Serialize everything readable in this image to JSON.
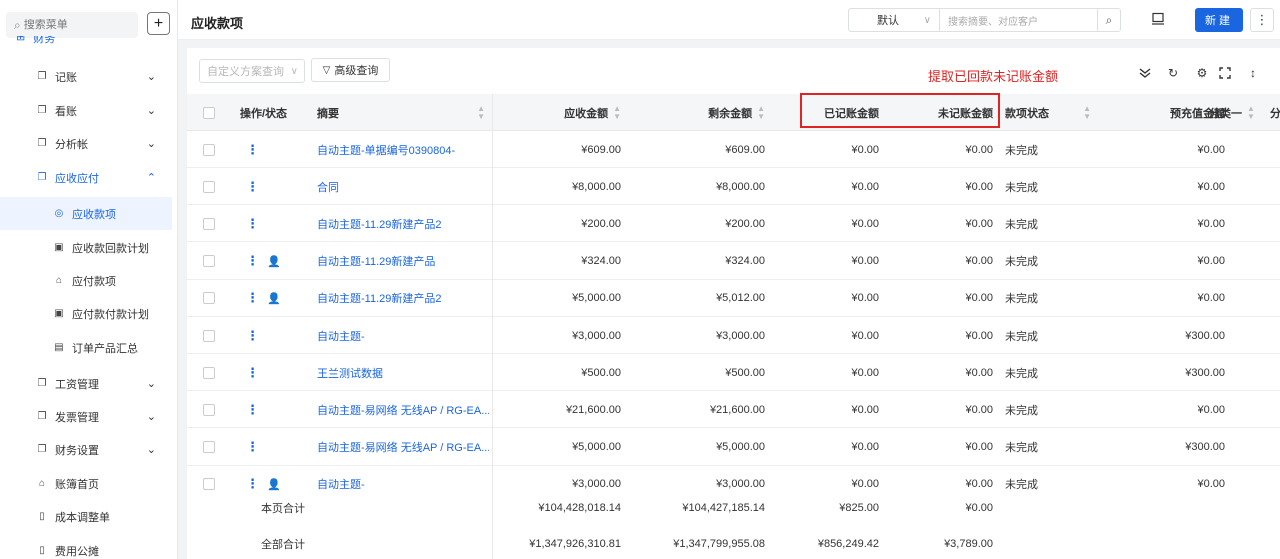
{
  "sidebar": {
    "search_placeholder": "搜索菜单",
    "add_label": "+",
    "group": {
      "label": "财务"
    },
    "items": [
      {
        "label": "记账",
        "icon": "copy-icon",
        "level": 1
      },
      {
        "label": "看账",
        "icon": "copy-icon",
        "level": 1
      },
      {
        "label": "分析帐",
        "icon": "copy-icon",
        "level": 1
      },
      {
        "label": "应收应付",
        "icon": "copy-icon",
        "level": 1,
        "open": true
      },
      {
        "label": "应收款项",
        "icon": "receivable-icon",
        "level": 2,
        "active": true
      },
      {
        "label": "应收款回款计划",
        "icon": "plan-icon",
        "level": 2
      },
      {
        "label": "应付款项",
        "icon": "payable-icon",
        "level": 2
      },
      {
        "label": "应付款付款计划",
        "icon": "plan-icon",
        "level": 2
      },
      {
        "label": "订单产品汇总",
        "icon": "summary-icon",
        "level": 2
      },
      {
        "label": "工资管理",
        "icon": "copy-icon",
        "level": 1
      },
      {
        "label": "发票管理",
        "icon": "copy-icon",
        "level": 1
      },
      {
        "label": "财务设置",
        "icon": "copy-icon",
        "level": 1
      },
      {
        "label": "账簿首页",
        "icon": "home-icon",
        "level": 0
      },
      {
        "label": "成本调整单",
        "icon": "document-icon",
        "level": 0
      },
      {
        "label": "费用公摊",
        "icon": "document-icon",
        "level": 0
      }
    ]
  },
  "header": {
    "title": "应收款项",
    "view_select": "默认",
    "search_placeholder": "搜索摘要、对应客户",
    "new_button": "新建"
  },
  "toolbar": {
    "scheme_placeholder": "自定义方案查询",
    "advanced_query": "高级查询",
    "annotation": "提取已回款未记账金额"
  },
  "table": {
    "headers": {
      "op": "操作/状态",
      "summary": "摘要",
      "receivable": "应收金额",
      "remaining": "剩余金额",
      "booked": "已记账金额",
      "unbooked": "未记账金额",
      "status": "款项状态",
      "prepaid": "预充值金额",
      "cat1": "分类一",
      "cat2": "分"
    },
    "rows": [
      {
        "summary": "自动主题-单据编号0390804-",
        "receivable": "¥609.00",
        "remaining": "¥609.00",
        "booked": "¥0.00",
        "unbooked": "¥0.00",
        "status": "未完成",
        "prepaid": "¥0.00",
        "person": false
      },
      {
        "summary": "合同",
        "receivable": "¥8,000.00",
        "remaining": "¥8,000.00",
        "booked": "¥0.00",
        "unbooked": "¥0.00",
        "status": "未完成",
        "prepaid": "¥0.00",
        "person": false
      },
      {
        "summary": "自动主题-11.29新建产品2",
        "receivable": "¥200.00",
        "remaining": "¥200.00",
        "booked": "¥0.00",
        "unbooked": "¥0.00",
        "status": "未完成",
        "prepaid": "¥0.00",
        "person": false
      },
      {
        "summary": "自动主题-11.29新建产品",
        "receivable": "¥324.00",
        "remaining": "¥324.00",
        "booked": "¥0.00",
        "unbooked": "¥0.00",
        "status": "未完成",
        "prepaid": "¥0.00",
        "person": true
      },
      {
        "summary": "自动主题-11.29新建产品2",
        "receivable": "¥5,000.00",
        "remaining": "¥5,012.00",
        "booked": "¥0.00",
        "unbooked": "¥0.00",
        "status": "未完成",
        "prepaid": "¥0.00",
        "person": true
      },
      {
        "summary": "自动主题-",
        "receivable": "¥3,000.00",
        "remaining": "¥3,000.00",
        "booked": "¥0.00",
        "unbooked": "¥0.00",
        "status": "未完成",
        "prepaid": "¥300.00",
        "person": false
      },
      {
        "summary": "王兰测试数据",
        "receivable": "¥500.00",
        "remaining": "¥500.00",
        "booked": "¥0.00",
        "unbooked": "¥0.00",
        "status": "未完成",
        "prepaid": "¥300.00",
        "person": false
      },
      {
        "summary": "自动主题-易网络 无线AP / RG-EA...",
        "receivable": "¥21,600.00",
        "remaining": "¥21,600.00",
        "booked": "¥0.00",
        "unbooked": "¥0.00",
        "status": "未完成",
        "prepaid": "¥0.00",
        "person": false
      },
      {
        "summary": "自动主题-易网络 无线AP / RG-EA...",
        "receivable": "¥5,000.00",
        "remaining": "¥5,000.00",
        "booked": "¥0.00",
        "unbooked": "¥0.00",
        "status": "未完成",
        "prepaid": "¥300.00",
        "person": false
      },
      {
        "summary": "自动主题-",
        "receivable": "¥3,000.00",
        "remaining": "¥3,000.00",
        "booked": "¥0.00",
        "unbooked": "¥0.00",
        "status": "未完成",
        "prepaid": "¥0.00",
        "person": true
      }
    ],
    "totals": [
      {
        "label": "本页合计",
        "receivable": "¥104,428,018.14",
        "remaining": "¥104,427,185.14",
        "booked": "¥825.00",
        "unbooked": "¥0.00"
      },
      {
        "label": "全部合计",
        "receivable": "¥1,347,926,310.81",
        "remaining": "¥1,347,799,955.08",
        "booked": "¥856,249.42",
        "unbooked": "¥3,789.00"
      }
    ]
  },
  "colors": {
    "accent": "#1a66e0",
    "annotation": "#e02424"
  }
}
